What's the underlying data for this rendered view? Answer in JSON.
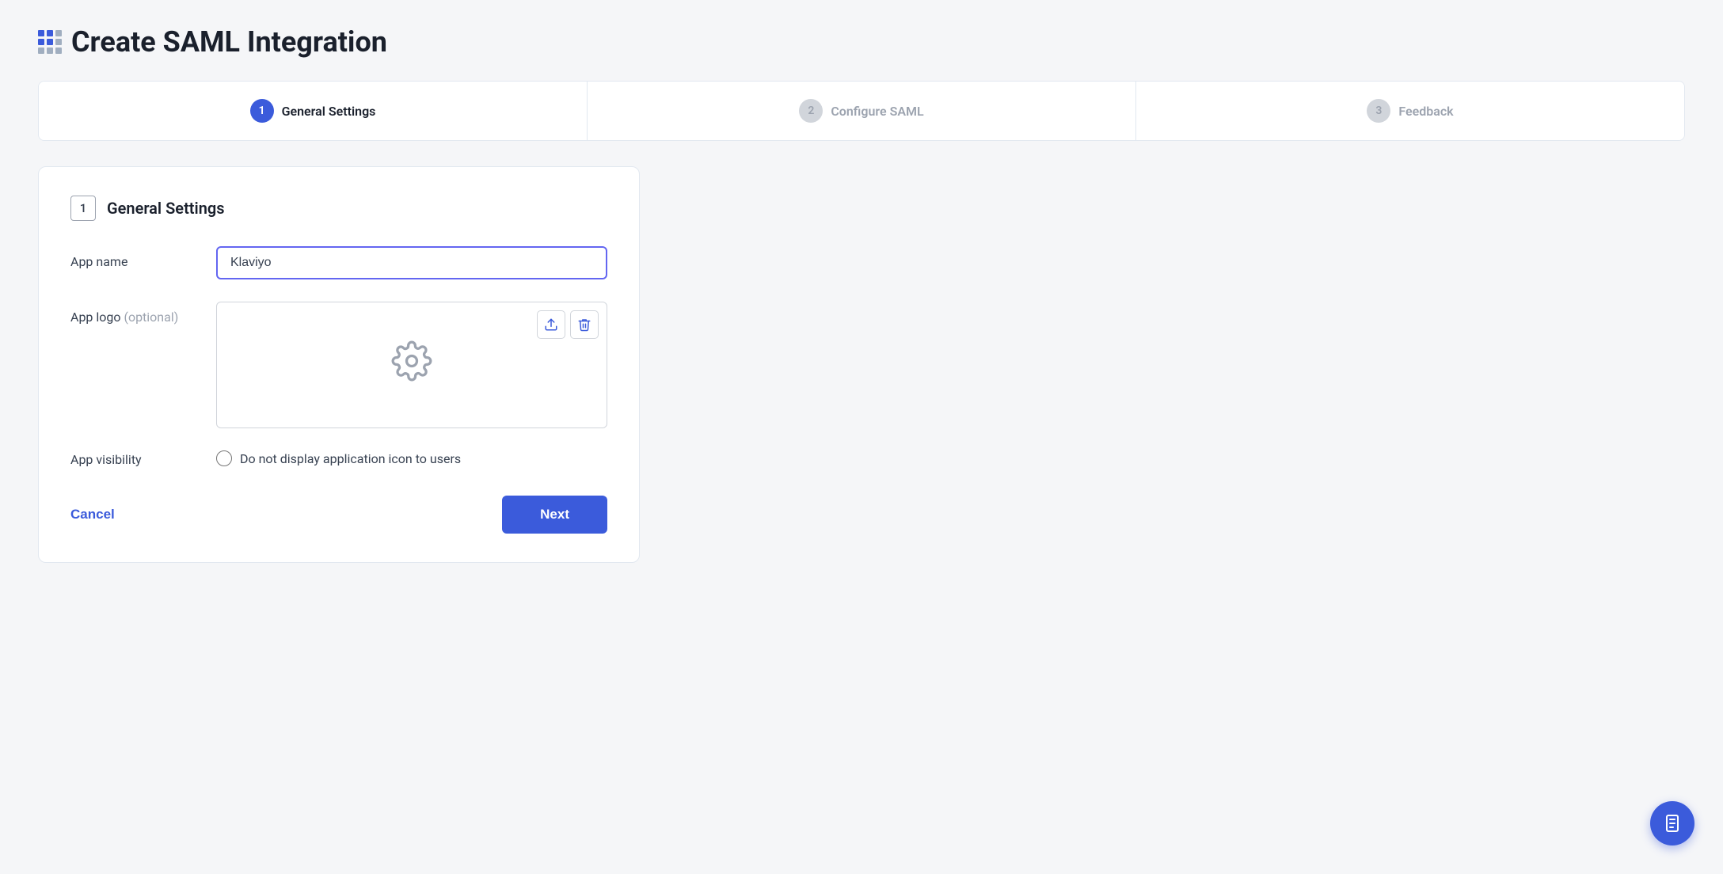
{
  "page": {
    "title": "Create SAML Integration"
  },
  "steps": [
    {
      "id": "general-settings",
      "number": "1",
      "label": "General Settings",
      "active": true
    },
    {
      "id": "configure-saml",
      "number": "2",
      "label": "Configure SAML",
      "active": false
    },
    {
      "id": "feedback",
      "number": "3",
      "label": "Feedback",
      "active": false
    }
  ],
  "section": {
    "number": "1",
    "title": "General Settings"
  },
  "form": {
    "app_name_label": "App name",
    "app_name_value": "Klaviyo",
    "app_name_placeholder": "",
    "app_logo_label": "App logo",
    "app_logo_optional": "(optional)",
    "app_visibility_label": "App visibility",
    "app_visibility_option": "Do not display application icon to users"
  },
  "buttons": {
    "cancel_label": "Cancel",
    "next_label": "Next",
    "upload_icon": "⬆",
    "delete_icon": "🗑",
    "fab_icon": "📋"
  }
}
